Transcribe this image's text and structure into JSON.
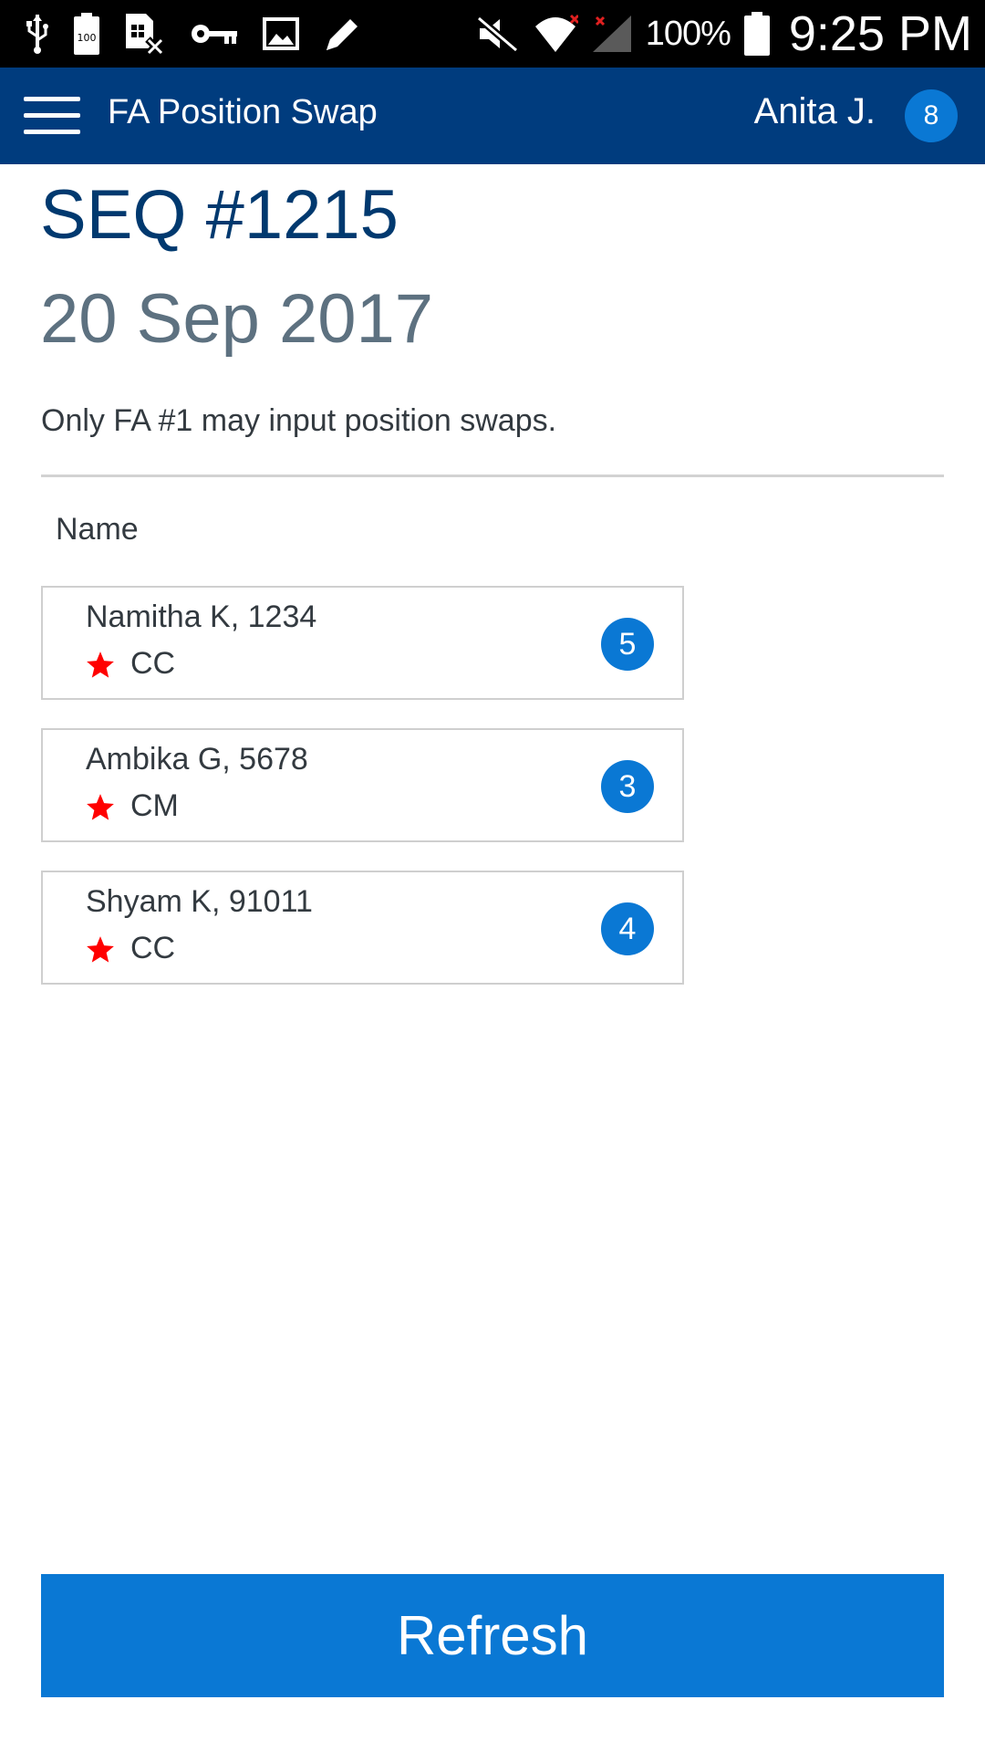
{
  "status_bar": {
    "left_icons": [
      "usb-icon",
      "battery-100-icon",
      "sim-card-off-icon",
      "vpn-key-icon",
      "gallery-image-icon",
      "edit-pencil-icon"
    ],
    "right_icons": [
      "mute-icon",
      "wifi-icon",
      "no-signal-icon",
      "battery-icon"
    ],
    "battery_text": "100%",
    "time": "9:25 PM"
  },
  "app_bar": {
    "title": "FA Position Swap",
    "user_name": "Anita J.",
    "user_badge": "8",
    "background": "#003c7e"
  },
  "header": {
    "seq": "SEQ #1215",
    "date": "20 Sep 2017",
    "notice": "Only FA #1 may input position swaps."
  },
  "list": {
    "column_header": "Name",
    "items": [
      {
        "name": "Namitha K, 1234",
        "role": "CC",
        "position": "5"
      },
      {
        "name": "Ambika G, 5678",
        "role": "CM",
        "position": "3"
      },
      {
        "name": "Shyam K, 91011",
        "role": "CC",
        "position": "4"
      }
    ]
  },
  "actions": {
    "refresh_label": "Refresh"
  },
  "colors": {
    "accent": "#0a78d4",
    "primary_dark": "#003c7e",
    "star": "#ff0000"
  }
}
